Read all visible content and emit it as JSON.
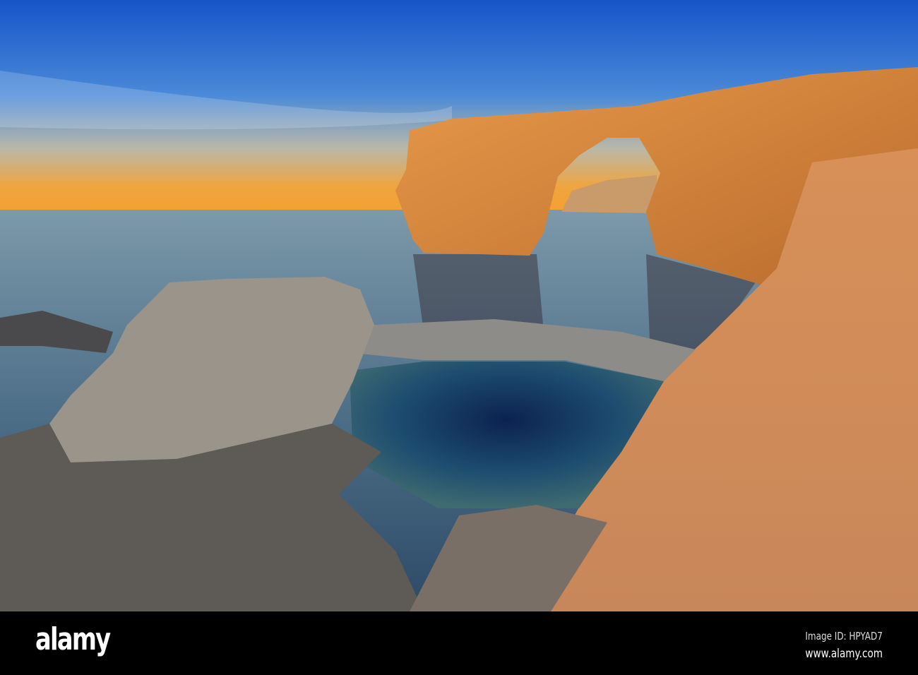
{
  "photo": {
    "subject": "Azure Window rock arch",
    "colors": {
      "sky_top": "#1a5fd0",
      "sky_horizon": "#f0a030",
      "sea": "#4f7a95",
      "rock_lit": "#d9893f",
      "rock_grey": "#8a857c",
      "pool": "#0e2a55"
    }
  },
  "watermark": "alamy",
  "footer": {
    "logo": "alamy",
    "image_id": "Image ID: HPYAD7",
    "website": "www.alamy.com"
  }
}
